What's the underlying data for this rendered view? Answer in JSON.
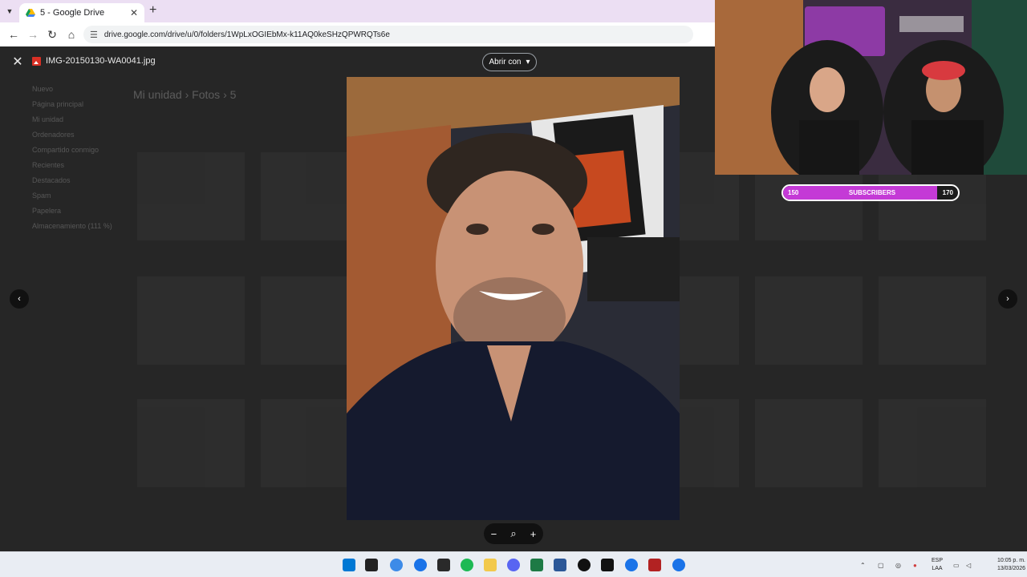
{
  "browser": {
    "tab_title": "5 - Google Drive",
    "url": "drive.google.com/drive/u/0/folders/1WpLxOGIEbMx-k11AQ0keSHzQPWRQTs6e"
  },
  "viewer": {
    "file_name": "IMG-20150130-WA0041.jpg",
    "open_with_label": "Abrir con"
  },
  "drive_bg": {
    "breadcrumb": [
      "Mi unidad",
      "Fotos",
      "5"
    ],
    "sidebar": [
      "Nuevo",
      "Página principal",
      "Mi unidad",
      "Ordenadores",
      "Compartido conmigo",
      "Recientes",
      "Destacados",
      "Spam",
      "Papelera",
      "Almacenamiento (111 %)"
    ]
  },
  "overlay": {
    "subs_start": "150",
    "subs_label": "SUBSCRIBERS",
    "subs_end": "170",
    "subs_progress": 0.88
  },
  "taskbar": {
    "lang_line1": "ESP",
    "lang_line2": "LAA",
    "time": "10:05 p. m.",
    "date": "13/03/2026"
  },
  "colors": {
    "accent_subs": "#c43ad6",
    "viewer_bg": "#262626",
    "tab_strip": "#ecdff3"
  }
}
